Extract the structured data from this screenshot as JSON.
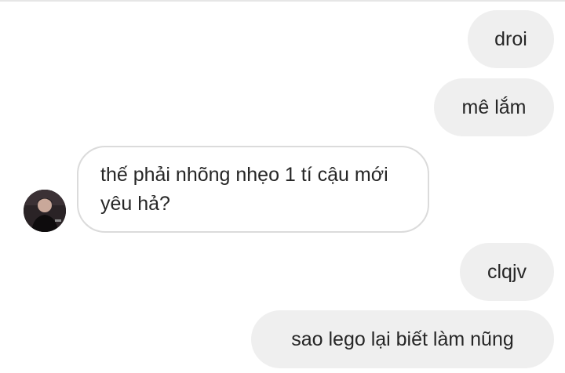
{
  "messages": [
    {
      "side": "outgoing",
      "text": "droi"
    },
    {
      "side": "outgoing",
      "text": "mê lắm"
    },
    {
      "side": "incoming",
      "text": "thế phải nhõng nhẹo 1 tí cậu mới yêu hả?"
    },
    {
      "side": "outgoing",
      "text": "clqjv"
    },
    {
      "side": "outgoing",
      "text": "sao lego lại biết làm nũng"
    }
  ],
  "colors": {
    "outgoing_bubble": "#efefef",
    "incoming_border": "#dbdbdb",
    "text": "#262626"
  }
}
